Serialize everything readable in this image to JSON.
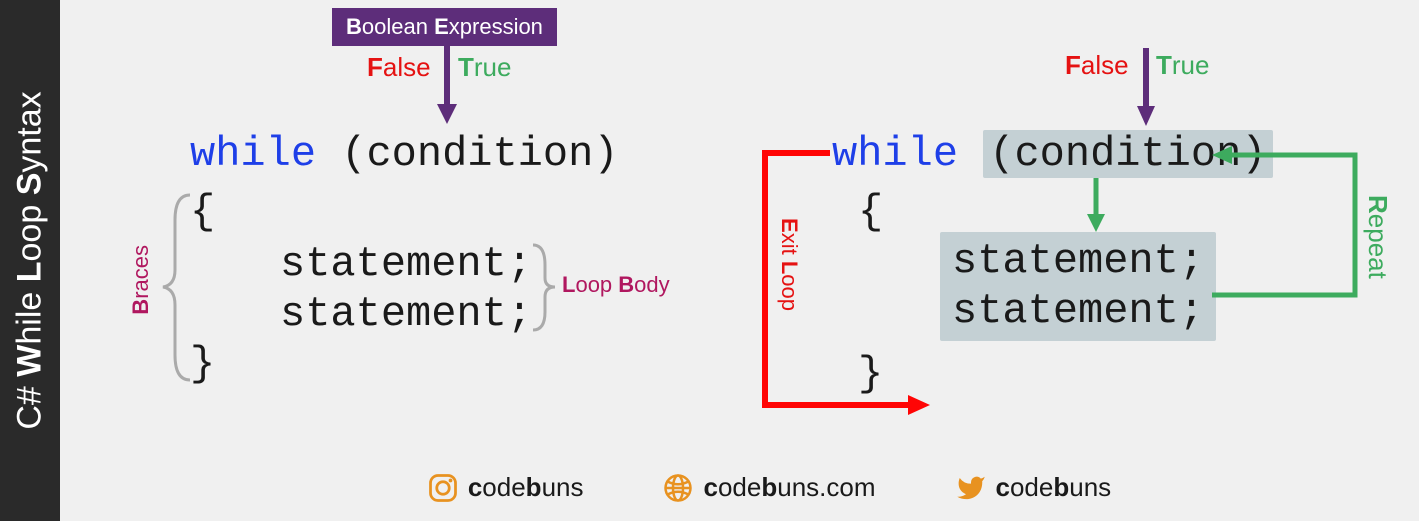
{
  "sidebar": {
    "title_html": "C# <b>W</b>hile <b>L</b>oop <b>S</b>yntax"
  },
  "left": {
    "badge": "<b>B</b>oolean <b>E</b>xpression",
    "false": "<b>F</b>alse",
    "true": "<b>T</b>rue",
    "while": "while",
    "cond_open": "(condition)",
    "brace_open": "{",
    "stmt1": "statement;",
    "stmt2": "statement;",
    "brace_close": "}",
    "braces_label": "<b>B</b>races",
    "body_label": "<b>L</b>oop <b>B</b>ody"
  },
  "right": {
    "false": "<b>F</b>alse",
    "true": "<b>T</b>rue",
    "while": "while",
    "cond": "(condition)",
    "brace_open": "{",
    "stmt1": "statement;",
    "stmt2": "statement;",
    "brace_close": "}",
    "exit_label": "<b>E</b>xit <b>L</b>oop",
    "repeat_label": "<b>R</b>epeat"
  },
  "footer": {
    "ig": "<b>c</b>ode<b>b</b>uns",
    "web": "<b>c</b>ode<b>b</b>uns.com",
    "tw": "<b>c</b>ode<b>b</b>uns"
  }
}
